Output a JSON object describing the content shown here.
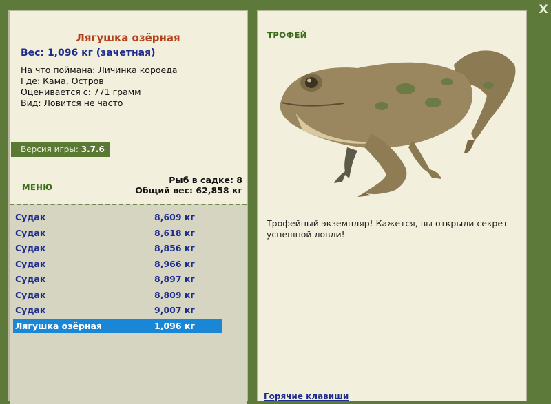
{
  "catch": {
    "title": "Лягушка озёрная",
    "weight_line": "Вес: 1,096 кг (зачетная)",
    "bait": "На что поймана: Личинка короеда",
    "location": "Где: Кама, Остров",
    "rated_from": "Оценивается с: 771 грамм",
    "rarity": "Вид: Ловится не часто"
  },
  "version": {
    "label": "Версия игры: ",
    "value": "3.7.6"
  },
  "menu_label": "МЕНЮ",
  "keepnet": {
    "count": "Рыб в садке: 8",
    "total_weight": "Общий вес: 62,858 кг"
  },
  "fish_list": [
    {
      "name": "Судак",
      "weight": "8,609 кг"
    },
    {
      "name": "Судак",
      "weight": "8,618 кг"
    },
    {
      "name": "Судак",
      "weight": "8,856 кг"
    },
    {
      "name": "Судак",
      "weight": "8,966 кг"
    },
    {
      "name": "Судак",
      "weight": "8,897 кг"
    },
    {
      "name": "Судак",
      "weight": "8,809 кг"
    },
    {
      "name": "Судак",
      "weight": "9,007 кг"
    },
    {
      "name": "Лягушка озёрная",
      "weight": "1,096 кг",
      "selected": true
    }
  ],
  "trophy": {
    "title": "ТРОФЕЙ",
    "image": "frog-image",
    "text": "Трофейный экземпляр! Кажется, вы открыли секрет успешной ловли!"
  },
  "hotkeys": "Горячие клавиши",
  "close_icon": "X",
  "colors": {
    "background": "#5e7a3a",
    "panel": "#f2efdd",
    "list": "#d6d5c1",
    "selected_row": "#1a86d6",
    "title": "#b5411a",
    "text_blue": "#1e2c8e"
  }
}
